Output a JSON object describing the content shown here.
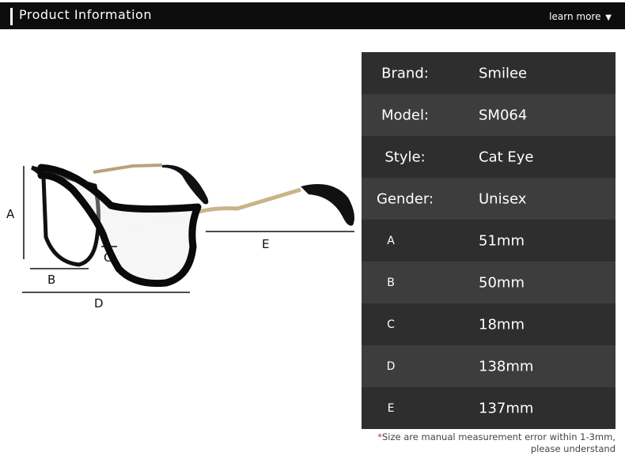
{
  "header": {
    "title": "Product Information",
    "learn_more": "learn more",
    "learn_more_arrow": "▼"
  },
  "illustration": {
    "labels": {
      "A": "A",
      "B": "B",
      "C": "C",
      "D": "D",
      "E": "E"
    }
  },
  "specs": [
    {
      "key": "Brand:",
      "value": "Smilee"
    },
    {
      "key": "Model:",
      "value": "SM064"
    },
    {
      "key": "Style:",
      "value": "Cat Eye"
    },
    {
      "key": "Gender:",
      "value": "Unisex"
    },
    {
      "key": "A",
      "value": "51mm"
    },
    {
      "key": "B",
      "value": "50mm"
    },
    {
      "key": "C",
      "value": "18mm"
    },
    {
      "key": "D",
      "value": "138mm"
    },
    {
      "key": "E",
      "value": "137mm"
    }
  ],
  "note": {
    "star": "*",
    "line1": "Size are manual measurement error within 1-3mm,",
    "line2": "please understand"
  }
}
